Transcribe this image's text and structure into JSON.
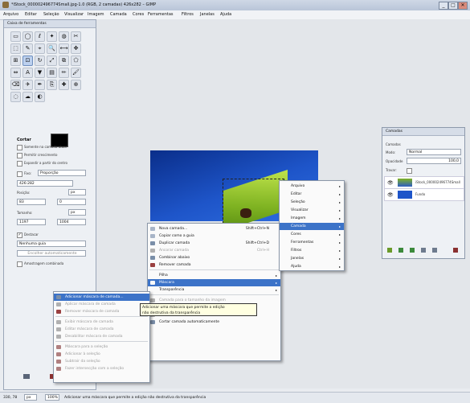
{
  "window": {
    "title": "*iStock_000002496774Small.jpg-1.0 (RGB, 2 camadas) 426x282 – GIMP",
    "controls": [
      "_",
      "□",
      "✕"
    ]
  },
  "menubar": [
    "Arquivo",
    "Editar",
    "Seleção",
    "Visualizar",
    "Imagem",
    "Camada",
    "Cores",
    "Ferramentas",
    "Filtros",
    "Janelas",
    "Ajuda"
  ],
  "toolbox": {
    "title": "Caixa de ferramentas",
    "tool_icons": [
      "rect-select-icon",
      "ellipse-select-icon",
      "free-select-icon",
      "fuzzy-select-icon",
      "color-select-icon",
      "scissors-icon",
      "foreground-select-icon",
      "paths-icon",
      "color-picker-icon",
      "zoom-icon",
      "measure-icon",
      "move-icon",
      "align-icon",
      "crop-icon",
      "rotate-icon",
      "scale-icon",
      "shear-icon",
      "perspective-icon",
      "flip-icon",
      "text-icon",
      "bucket-fill-icon",
      "blend-icon",
      "pencil-icon",
      "paintbrush-icon",
      "eraser-icon",
      "airbrush-icon",
      "ink-icon",
      "clone-icon",
      "heal-icon",
      "perspective-clone-icon",
      "blur-icon",
      "smudge-icon",
      "dodge-icon"
    ],
    "options": {
      "heading": "Cortar",
      "chk1": "Somente na camada atual",
      "chk2": "Permitir crescimento",
      "chk3": "Expandir a partir do centro",
      "fixed_label": "Fixo:",
      "fixed_value": "Proporção",
      "ratio_value": "426:282",
      "position_label": "Posição:",
      "position_unit": "px",
      "position_x": "83",
      "position_y": "0",
      "size_label": "Tamanho:",
      "size_unit": "px",
      "size_w": "1197",
      "size_h": "1004",
      "highlight_label": "Destacar",
      "guide_value": "Nenhuma guia",
      "autoshrink_label": "Encolher automaticamente",
      "shrink_merged_label": "Amostragem combinada"
    }
  },
  "layer_menu": {
    "items": [
      {
        "label": "Arquivo"
      },
      {
        "label": "Editar"
      },
      {
        "label": "Seleção"
      },
      {
        "label": "Visualizar"
      },
      {
        "label": "Imagem"
      },
      {
        "label": "Camada"
      },
      {
        "label": "Cores"
      },
      {
        "label": "Ferramentas"
      },
      {
        "label": "Filtros"
      },
      {
        "label": "Janelas"
      },
      {
        "label": "Ajuda"
      }
    ]
  },
  "context_menu": {
    "items": [
      {
        "label": "Nova camada...",
        "key": "Shift+Ctrl+N"
      },
      {
        "label": "Copiar como a guia",
        "key": ""
      },
      {
        "label": "Duplicar camada",
        "key": "Shift+Ctrl+D"
      },
      {
        "label": "Ancorar camada",
        "key": "Ctrl+H"
      },
      {
        "label": "Combinar abaixo",
        "key": ""
      },
      {
        "label": "Remover camada",
        "key": ""
      },
      {
        "label": "Pilha",
        "key": ""
      },
      {
        "label": "Máscara",
        "key": ""
      },
      {
        "label": "Transparência",
        "key": ""
      },
      {
        "label": "Camada para o tamanho da imagem",
        "key": ""
      },
      {
        "label": "Redimensionar camada...",
        "key": ""
      },
      {
        "label": "Cortar para a seleção",
        "key": ""
      },
      {
        "label": "Cortar camada automaticamente",
        "key": ""
      }
    ]
  },
  "mask_menu": {
    "items": [
      {
        "label": "Adicionar máscara de camada..."
      },
      {
        "label": "Aplicar máscara de camada"
      },
      {
        "label": "Remover máscara de camada"
      },
      {
        "label": "Exibir máscara de camada"
      },
      {
        "label": "Editar máscara de camada"
      },
      {
        "label": "Desabilitar máscara de camada"
      },
      {
        "label": "Máscara para a seleção"
      },
      {
        "label": "Adicionar à seleção"
      },
      {
        "label": "Subtrair da seleção"
      },
      {
        "label": "Fazer intersecção com a seleção"
      }
    ]
  },
  "tooltip": {
    "line1": "Adicionar uma máscara que permite a edição",
    "line2": "não destrutiva da transparência"
  },
  "layers_panel": {
    "title": "Camadas",
    "tab": "Camadas",
    "mode_label": "Modo:",
    "mode_value": "Normal",
    "opacity_label": "Opacidade",
    "opacity_value": "100,0",
    "lock_label": "Travar:",
    "layers": [
      {
        "name": "iStock_000002496774Small"
      },
      {
        "name": "Fundo"
      }
    ]
  },
  "statusbar": {
    "coords": "330, 78",
    "unit": "px",
    "zoom": "100%",
    "message": "Adicionar uma máscara que permite a edição não destrutiva da transparência"
  }
}
